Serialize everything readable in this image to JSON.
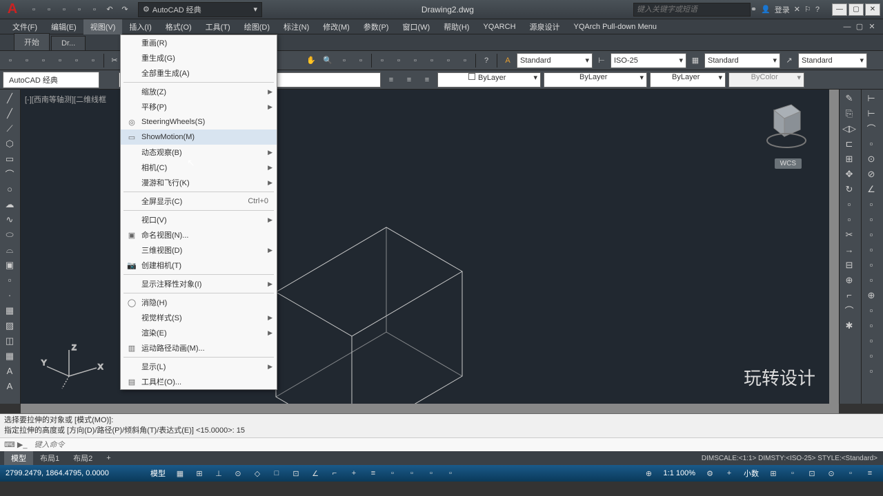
{
  "title_bar": {
    "workspace": "AutoCAD 经典",
    "document": "Drawing2.dwg",
    "search_placeholder": "键入关键字或短语",
    "login": "登录"
  },
  "menu": {
    "items": [
      "文件(F)",
      "编辑(E)",
      "视图(V)",
      "插入(I)",
      "格式(O)",
      "工具(T)",
      "绘图(D)",
      "标注(N)",
      "修改(M)",
      "参数(P)",
      "窗口(W)",
      "帮助(H)",
      "YQARCH",
      "源泉设计",
      "YQArch Pull-down Menu"
    ],
    "active_index": 2
  },
  "file_tabs": {
    "tabs": [
      "开始",
      "Dr..."
    ],
    "active": 0
  },
  "toolbar": {
    "style1": "Standard",
    "style2": "ISO-25",
    "style3": "Standard",
    "style4": "Standard"
  },
  "layer_row": {
    "workspace_label": "AutoCAD 经典",
    "layer": "",
    "prop1": "ByLayer",
    "prop2": "ByLayer",
    "prop3": "ByLayer",
    "color": "ByColor"
  },
  "viewport_label": "[-][西南等轴测][二维线框",
  "wcs": "WCS",
  "watermark": "玩转设计",
  "dropdown": {
    "items": [
      {
        "label": "重画(R)",
        "icon": "",
        "arrow": false
      },
      {
        "label": "重生成(G)",
        "icon": "",
        "arrow": false
      },
      {
        "label": "全部重生成(A)",
        "icon": "",
        "arrow": false
      },
      {
        "sep": true
      },
      {
        "label": "缩放(Z)",
        "icon": "",
        "arrow": true
      },
      {
        "label": "平移(P)",
        "icon": "",
        "arrow": true
      },
      {
        "label": "SteeringWheels(S)",
        "icon": "◎",
        "arrow": false
      },
      {
        "label": "ShowMotion(M)",
        "icon": "▭",
        "arrow": false,
        "highlight": true
      },
      {
        "label": "动态观察(B)",
        "icon": "",
        "arrow": true
      },
      {
        "label": "相机(C)",
        "icon": "",
        "arrow": true
      },
      {
        "label": "漫游和飞行(K)",
        "icon": "",
        "arrow": true
      },
      {
        "sep": true
      },
      {
        "label": "全屏显示(C)",
        "icon": "",
        "arrow": false,
        "shortcut": "Ctrl+0"
      },
      {
        "sep": true
      },
      {
        "label": "视口(V)",
        "icon": "",
        "arrow": true
      },
      {
        "label": "命名视图(N)...",
        "icon": "▣",
        "arrow": false
      },
      {
        "label": "三维视图(D)",
        "icon": "",
        "arrow": true
      },
      {
        "label": "创建相机(T)",
        "icon": "📷",
        "arrow": false
      },
      {
        "sep": true
      },
      {
        "label": "显示注释性对象(I)",
        "icon": "",
        "arrow": true
      },
      {
        "sep": true
      },
      {
        "label": "消隐(H)",
        "icon": "◯",
        "arrow": false
      },
      {
        "label": "视觉样式(S)",
        "icon": "",
        "arrow": true
      },
      {
        "label": "渲染(E)",
        "icon": "",
        "arrow": true
      },
      {
        "label": "运动路径动画(M)...",
        "icon": "▥",
        "arrow": false
      },
      {
        "sep": true
      },
      {
        "label": "显示(L)",
        "icon": "",
        "arrow": true
      },
      {
        "label": "工具栏(O)...",
        "icon": "▤",
        "arrow": false
      }
    ]
  },
  "cmd": {
    "line1": "选择要拉伸的对象或 [模式(MO)]:",
    "line2": "指定拉伸的高度或 [方向(D)/路径(P)/倾斜角(T)/表达式(E)] <15.0000>: 15",
    "placeholder": "键入命令"
  },
  "layout_tabs": {
    "tabs": [
      "模型",
      "布局1",
      "布局2",
      "+"
    ],
    "active": 0
  },
  "dim_status": "DIMSCALE:<1:1> DIMSTY:<ISO-25> STYLE:<Standard>",
  "status": {
    "coords": "2799.2479, 1864.4795, 0.0000",
    "model": "模型",
    "scale": "1:1  100%",
    "annoscale": "小数"
  }
}
